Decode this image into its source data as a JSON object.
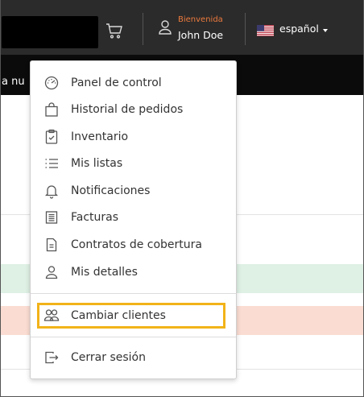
{
  "header": {
    "welcome_label": "Bienvenida",
    "user_name": "John Doe",
    "language": "español",
    "welcome_color": "#ec7a3d"
  },
  "banner": {
    "text_fragment": "a nu"
  },
  "menu": {
    "items": [
      {
        "label": "Panel de control",
        "icon": "dashboard-gauge-icon"
      },
      {
        "label": "Historial de pedidos",
        "icon": "shopping-bag-icon"
      },
      {
        "label": "Inventario",
        "icon": "clipboard-check-icon"
      },
      {
        "label": "Mis listas",
        "icon": "list-icon"
      },
      {
        "label": "Notificaciones",
        "icon": "bell-icon"
      },
      {
        "label": "Facturas",
        "icon": "invoice-icon"
      },
      {
        "label": "Contratos de cobertura",
        "icon": "document-icon"
      },
      {
        "label": "Mis detalles",
        "icon": "user-icon"
      },
      {
        "label": "Cambiar clientes",
        "icon": "users-switch-icon",
        "highlighted": true
      },
      {
        "label": "Cerrar sesión",
        "icon": "logout-icon"
      }
    ],
    "highlight_color": "#f2b319"
  }
}
